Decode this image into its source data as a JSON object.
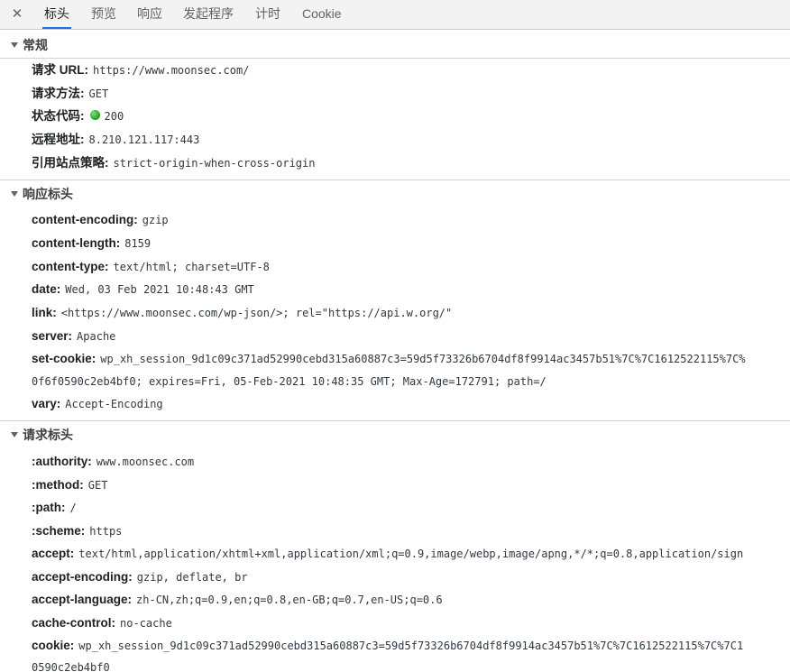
{
  "tabs": {
    "close": "✕",
    "headers": "标头",
    "preview": "预览",
    "response": "响应",
    "initiator": "发起程序",
    "timing": "计时",
    "cookie": "Cookie"
  },
  "general": {
    "title": "常规",
    "request_url_key": "请求 URL:",
    "request_url_val": "https://www.moonsec.com/",
    "method_key": "请求方法:",
    "method_val": "GET",
    "status_key": "状态代码:",
    "status_val": "200",
    "status_color": "#1e9e1e",
    "remote_key": "远程地址:",
    "remote_val": "8.210.121.117:443",
    "referrer_key": "引用站点策略:",
    "referrer_val": "strict-origin-when-cross-origin"
  },
  "response_headers": {
    "title": "响应标头",
    "ce_key": "content-encoding:",
    "ce_val": "gzip",
    "cl_key": "content-length:",
    "cl_val": "8159",
    "ct_key": "content-type:",
    "ct_val": "text/html; charset=UTF-8",
    "date_key": "date:",
    "date_val": "Wed, 03 Feb 2021 10:48:43 GMT",
    "link_key": "link:",
    "link_val": "<https://www.moonsec.com/wp-json/>; rel=\"https://api.w.org/\"",
    "server_key": "server:",
    "server_val": "Apache",
    "setcookie_key": "set-cookie:",
    "setcookie_val_1": "wp_xh_session_9d1c09c371ad52990cebd315a60887c3=59d5f73326b6704df8f9914ac3457b51%7C%7C1612522115%7C%",
    "setcookie_val_2": "0f6f0590c2eb4bf0; expires=Fri, 05-Feb-2021 10:48:35 GMT; Max-Age=172791; path=/",
    "vary_key": "vary:",
    "vary_val": "Accept-Encoding"
  },
  "request_headers": {
    "title": "请求标头",
    "authority_key": ":authority:",
    "authority_val": "www.moonsec.com",
    "method_key": ":method:",
    "method_val": "GET",
    "path_key": ":path:",
    "path_val": "/",
    "scheme_key": ":scheme:",
    "scheme_val": "https",
    "accept_key": "accept:",
    "accept_val": "text/html,application/xhtml+xml,application/xml;q=0.9,image/webp,image/apng,*/*;q=0.8,application/sign",
    "ae_key": "accept-encoding:",
    "ae_val": "gzip, deflate, br",
    "al_key": "accept-language:",
    "al_val": "zh-CN,zh;q=0.9,en;q=0.8,en-GB;q=0.7,en-US;q=0.6",
    "cc_key": "cache-control:",
    "cc_val": "no-cache",
    "cookie_key": "cookie:",
    "cookie_val_1": "wp_xh_session_9d1c09c371ad52990cebd315a60887c3=59d5f73326b6704df8f9914ac3457b51%7C%7C1612522115%7C%7C1",
    "cookie_val_2": "0590c2eb4bf0"
  }
}
